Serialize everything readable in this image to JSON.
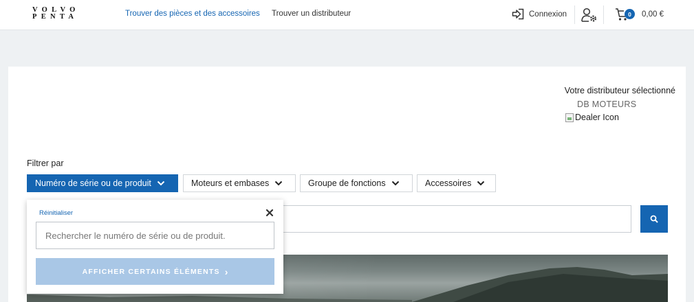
{
  "header": {
    "logo_line1": "VOLVO",
    "logo_line2": "PENTA",
    "nav_parts": "Trouver des pièces et des accessoires",
    "nav_distributor": "Trouver un distributeur",
    "login_label": "Connexion",
    "cart_count": "0",
    "cart_total": "0,00 €"
  },
  "dealer": {
    "label": "Votre distributeur sélectionné",
    "name": "DB MOTEURS",
    "icon_alt": "Dealer Icon"
  },
  "filters": {
    "label": "Filtrer par",
    "buttons": [
      {
        "label": "Numéro de série ou de produit",
        "active": true
      },
      {
        "label": "Moteurs et embases",
        "active": false
      },
      {
        "label": "Groupe de fonctions",
        "active": false
      },
      {
        "label": "Accessoires",
        "active": false
      }
    ]
  },
  "dropdown": {
    "reset_label": "Réinitialiser",
    "search_placeholder": "Rechercher le numéro de série ou de produit.",
    "submit_label": "AFFICHER CERTAINS ÉLÉMENTS",
    "submit_chevron": "›"
  },
  "colors": {
    "accent": "#1565b2",
    "submit_disabled": "#a9c7e6",
    "page_bg": "#eef1f3"
  },
  "icons": {
    "login": "login-arrow-icon",
    "user_settings": "user-gear-icon",
    "cart": "shopping-cart-icon",
    "search": "search-icon",
    "close": "close-icon",
    "chevron": "chevron-down-icon"
  }
}
